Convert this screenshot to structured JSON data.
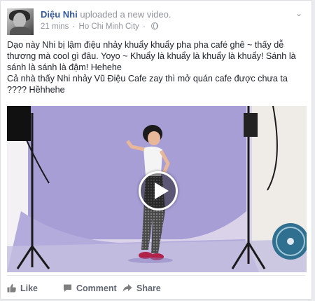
{
  "post": {
    "author": "Diệu Nhi",
    "action_text": "uploaded a new video.",
    "time": "21 mins",
    "location": "Ho Chi Minh City",
    "body_lines": [
      "Dạo này Nhi bị lậm điệu nhảy khuẩy khuẩy pha pha café ghê ~ thấy dễ thương mà cool gì đâu. Yoyo ~ Khuẩy là khuẩy là khuẩy là khuẩy! Sánh là sánh là sánh là đậm! Hehehe",
      "Cả nhà thấy Nhi nhảy Vũ Điệu Cafe zay thì mở quán cafe được chưa ta ???? Hềhhehe"
    ]
  },
  "actions": {
    "like": "Like",
    "comment": "Comment",
    "share": "Share"
  },
  "icons": {
    "options": "chevron-down-icon",
    "privacy": "globe-icon",
    "like": "thumbs-up-icon",
    "comment": "speech-bubble-icon",
    "share": "share-arrow-icon",
    "play": "play-icon"
  },
  "colors": {
    "author_link": "#365899",
    "meta_text": "#90949c",
    "action_text": "#606770",
    "backdrop": "#a59bd6"
  }
}
